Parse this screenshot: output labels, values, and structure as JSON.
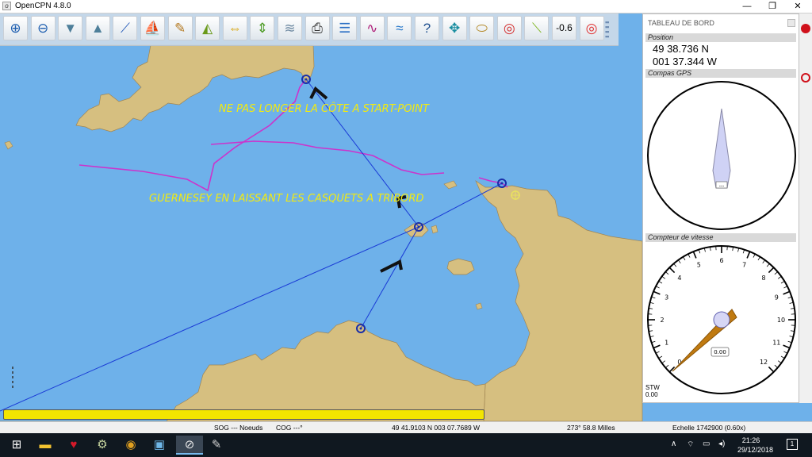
{
  "window": {
    "title": "OpenCPN 4.8.0",
    "buttons": [
      "—",
      "❐",
      "✕"
    ]
  },
  "toolbar": {
    "buttons": [
      {
        "name": "zoom-in-button",
        "icon": "zoom-in-icon",
        "glyph": "⊕",
        "color": "#1f5fb0"
      },
      {
        "name": "zoom-out-button",
        "icon": "zoom-out-icon",
        "glyph": "⊖",
        "color": "#1f5fb0"
      },
      {
        "name": "scale-in-button",
        "icon": "scale-in-icon",
        "glyph": "▼",
        "color": "#4e7f9a"
      },
      {
        "name": "scale-out-button",
        "icon": "scale-out-icon",
        "glyph": "▲",
        "color": "#4e7f9a"
      },
      {
        "name": "route-button",
        "icon": "route-icon",
        "glyph": "⟋",
        "color": "#2459b8"
      },
      {
        "name": "ship-button",
        "icon": "ship-icon",
        "glyph": "⛵",
        "color": "#c0183a"
      },
      {
        "name": "settings-button",
        "icon": "wrench-icon",
        "glyph": "✎",
        "color": "#b57a22"
      },
      {
        "name": "follow-button",
        "icon": "follow-icon",
        "glyph": "◭",
        "color": "#6a9a1a"
      },
      {
        "name": "stretch-horizontal-button",
        "icon": "stretch-horizontal-icon",
        "glyph": "⇔",
        "color": "#d8a200"
      },
      {
        "name": "stretch-vertical-button",
        "icon": "stretch-vertical-icon",
        "glyph": "⇕",
        "color": "#4a9a22"
      },
      {
        "name": "text-button",
        "icon": "text-icon",
        "glyph": "≋",
        "color": "#6f8aa2"
      },
      {
        "name": "print-button",
        "icon": "print-icon",
        "glyph": "⎙",
        "color": "#333333"
      },
      {
        "name": "route-manager-button",
        "icon": "route-manager-icon",
        "glyph": "☰",
        "color": "#2a6fc4"
      },
      {
        "name": "track-button",
        "icon": "track-icon",
        "glyph": "∿",
        "color": "#b0207a"
      },
      {
        "name": "tides-button",
        "icon": "tides-icon",
        "glyph": "≈",
        "color": "#1d72c8"
      },
      {
        "name": "help-button",
        "icon": "help-icon",
        "glyph": "?",
        "color": "#1f4f8f"
      },
      {
        "name": "ais-button",
        "icon": "ais-icon",
        "glyph": "✥",
        "color": "#1a8ea0"
      },
      {
        "name": "chart-quilt-button",
        "icon": "quilt-icon",
        "glyph": "⬭",
        "color": "#b58a2a"
      },
      {
        "name": "mob-button",
        "icon": "lifebuoy-icon",
        "glyph": "◎",
        "color": "#d43030"
      },
      {
        "name": "measure-button",
        "icon": "measure-icon",
        "glyph": "⟍",
        "color": "#7cb31a"
      },
      {
        "name": "depth-button",
        "icon": "depth-icon",
        "glyph": "-0.6",
        "color": "#000000",
        "is_text": true
      },
      {
        "name": "lifebuoy-button",
        "icon": "lifebuoy-icon",
        "glyph": "◎",
        "color": "#e03030"
      }
    ]
  },
  "map": {
    "colors": {
      "sea": "#6eb1ea",
      "land": "#d6bf80",
      "land_edge": "#a08552",
      "route": "#1a3bd6",
      "track": "#cc33cc",
      "annotation": "#f2ea10"
    },
    "annotations": [
      "NE PAS LONGER LA CÔTE A START-POINT",
      "GUERNESEY EN LAISSANT LES CASQUETS A TRIBORD"
    ]
  },
  "dashboard": {
    "title": "TABLEAU DE BORD",
    "position": {
      "header": "Position",
      "lat": "49 38.736 N",
      "lon": "001 37.344 W"
    },
    "compass": {
      "header": "Compas GPS",
      "bearing_deg": 0,
      "readout": "---"
    },
    "speedometer": {
      "header": "Compteur de vitesse",
      "ticks": [
        "0",
        "1",
        "2",
        "3",
        "4",
        "5",
        "6",
        "7",
        "8",
        "9",
        "10",
        "11",
        "12"
      ],
      "value_readout": "0.00",
      "stw_label": "STW",
      "stw_value": "0.00",
      "needle_value": 0
    }
  },
  "statusbar": {
    "sog": "SOG --- Noeuds",
    "cog": "COG ---°",
    "cursor_pos": "49 41.9103 N   003 07.7689 W",
    "cursor_bearing": "273°  58.8 Milles",
    "scale": "Echelle 1742900 (0.60x)"
  },
  "taskbar": {
    "apps": [
      {
        "name": "start-button",
        "icon": "windows-icon",
        "glyph": "⊞",
        "color": "#ffffff"
      },
      {
        "name": "file-explorer-button",
        "icon": "folder-icon",
        "glyph": "▬",
        "color": "#f2c230"
      },
      {
        "name": "heart-app-button",
        "icon": "heart-icon",
        "glyph": "♥",
        "color": "#d41a2a"
      },
      {
        "name": "settings-app-button",
        "icon": "gear-icon",
        "glyph": "⚙",
        "color": "#c8d6a0"
      },
      {
        "name": "chrome-button",
        "icon": "chrome-icon",
        "glyph": "◉",
        "color": "#e0a020"
      },
      {
        "name": "screen-app-button",
        "icon": "monitor-icon",
        "glyph": "▣",
        "color": "#6fb7e8"
      },
      {
        "name": "opencpn-taskbar-button",
        "icon": "opencpn-icon",
        "glyph": "⊘",
        "color": "#e8e8e8",
        "active": true
      },
      {
        "name": "notepad-taskbar-button",
        "icon": "notepad-icon",
        "glyph": "✎",
        "color": "#cfcfcf"
      }
    ],
    "tray": {
      "chevron": "∧",
      "time": "21:26",
      "date": "29/12/2018",
      "notifications": "1"
    }
  }
}
